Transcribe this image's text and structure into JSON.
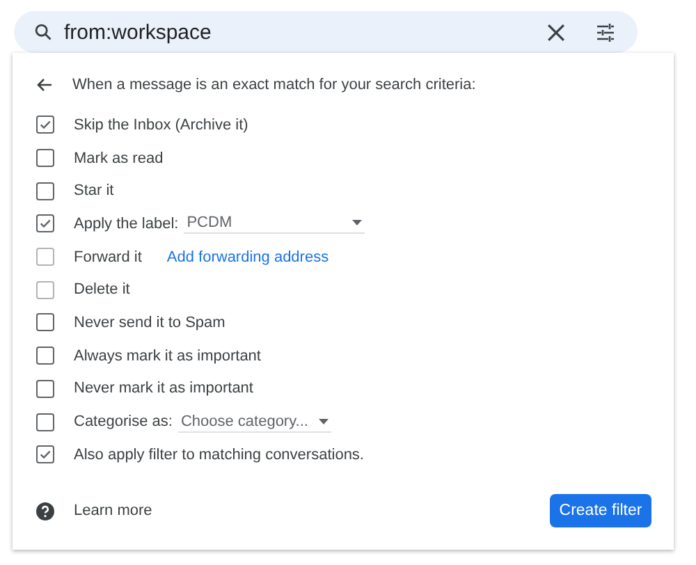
{
  "search": {
    "value": "from:workspace"
  },
  "filter": {
    "heading": "When a message is an exact match for your search criteria:",
    "options": [
      {
        "kind": "plain",
        "label": "Skip the Inbox (Archive it)",
        "checked": true,
        "disabled": false
      },
      {
        "kind": "plain",
        "label": "Mark as read",
        "checked": false,
        "disabled": false
      },
      {
        "kind": "plain",
        "label": "Star it",
        "checked": false,
        "disabled": false
      },
      {
        "kind": "select",
        "label": "Apply the label:",
        "value": "PCDM",
        "checked": true,
        "disabled": false
      },
      {
        "kind": "link",
        "label": "Forward it",
        "link": "Add forwarding address",
        "checked": false,
        "disabled": true
      },
      {
        "kind": "plain",
        "label": "Delete it",
        "checked": false,
        "disabled": true
      },
      {
        "kind": "plain",
        "label": "Never send it to Spam",
        "checked": false,
        "disabled": false
      },
      {
        "kind": "plain",
        "label": "Always mark it as important",
        "checked": false,
        "disabled": false
      },
      {
        "kind": "plain",
        "label": "Never mark it as important",
        "checked": false,
        "disabled": false
      },
      {
        "kind": "select",
        "label": "Categorise as:",
        "value": "Choose category...",
        "checked": false,
        "disabled": false
      },
      {
        "kind": "plain",
        "label": "Also apply filter to matching conversations.",
        "checked": true,
        "disabled": false
      }
    ],
    "learn_more": "Learn more",
    "create_button": "Create filter"
  }
}
